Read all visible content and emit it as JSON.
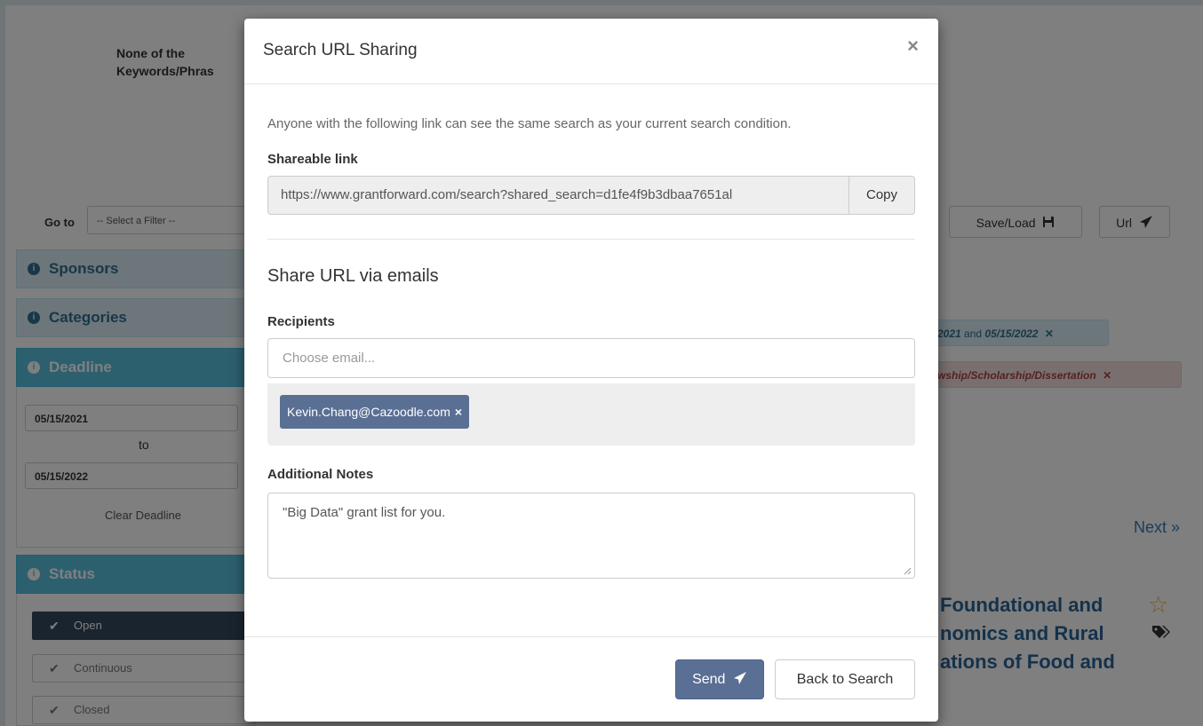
{
  "background": {
    "keywords_label_line1": "None of the",
    "keywords_label_line2": "Keywords/Phras",
    "goto_label": "Go to",
    "goto_select_value": "-- Select a Filter --",
    "save_load_label": "Save/Load",
    "url_label": "Url",
    "panels": {
      "sponsors": "Sponsors",
      "categories": "Categories",
      "deadline": "Deadline",
      "status": "Status"
    },
    "deadline": {
      "from": "05/15/2021",
      "to_label": "to",
      "to": "05/15/2022",
      "clear_label": "Clear Deadline"
    },
    "status_options": {
      "open": "Open",
      "continuous": "Continuous",
      "closed": "Closed"
    },
    "filter_chips": {
      "date_start": "2021",
      "date_and": " and ",
      "date_end": "05/15/2022",
      "type_chip": "wship/Scholarship/Dissertation"
    },
    "next_label": "Next »",
    "result_title": {
      "line1": "Foundational and",
      "line2": "nomics and Rural",
      "line3": "ations of Food and"
    }
  },
  "modal": {
    "title": "Search URL Sharing",
    "close_label": "×",
    "description": "Anyone with the following link can see the same search as your current search condition.",
    "shareable_link_label": "Shareable link",
    "shareable_link_value": "https://www.grantforward.com/search?shared_search=d1fe4f9b3dbaa7651al",
    "copy_label": "Copy",
    "share_section_title": "Share URL via emails",
    "recipients_label": "Recipients",
    "recipients_placeholder": "Choose email...",
    "recipient_chip": "Kevin.Chang@Cazoodle.com",
    "remove_chip_label": "×",
    "notes_label": "Additional Notes",
    "notes_value": "\"Big Data\" grant list for you.",
    "send_label": "Send",
    "back_label": "Back to Search"
  },
  "colors": {
    "backdrop": "rgba(0,0,0,0.5)",
    "primary_button": "#5a6f94",
    "panel_active": "#5bc0de",
    "status_selected": "#34495e"
  }
}
